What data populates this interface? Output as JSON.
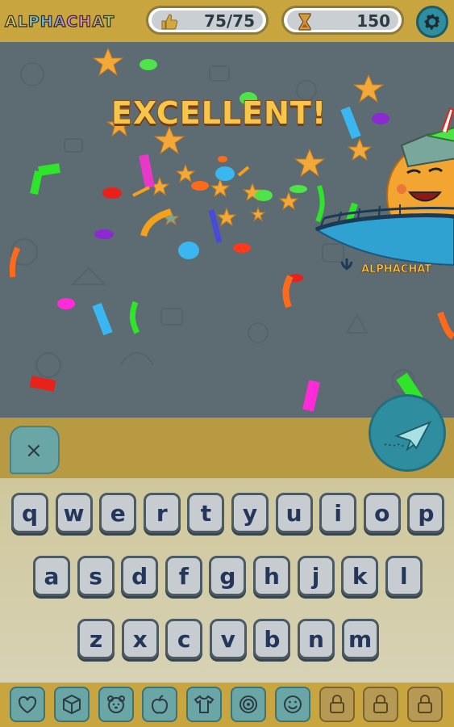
{
  "header": {
    "logo_text": "ALPHACHAT",
    "likes_counter": "75/75",
    "timer_counter": "150"
  },
  "game": {
    "message": "EXCELLENT!",
    "boat_text": "ALPHACHAT"
  },
  "input": {
    "clear_label": "×"
  },
  "keyboard": {
    "row1": [
      "q",
      "w",
      "e",
      "r",
      "t",
      "y",
      "u",
      "i",
      "o",
      "p"
    ],
    "row2": [
      "a",
      "s",
      "d",
      "f",
      "g",
      "h",
      "j",
      "k",
      "l"
    ],
    "row3": [
      "z",
      "x",
      "c",
      "v",
      "b",
      "n",
      "m"
    ]
  },
  "toolbar": {
    "items": [
      {
        "icon": "heart-icon",
        "locked": false
      },
      {
        "icon": "cube-icon",
        "locked": false
      },
      {
        "icon": "bear-face-icon",
        "locked": false
      },
      {
        "icon": "apple-icon",
        "locked": false
      },
      {
        "icon": "shirt-icon",
        "locked": false
      },
      {
        "icon": "target-icon",
        "locked": false
      },
      {
        "icon": "smiley-icon",
        "locked": false
      },
      {
        "icon": "lock-icon",
        "locked": true
      },
      {
        "icon": "lock-icon",
        "locked": true
      },
      {
        "icon": "lock-icon",
        "locked": true
      }
    ]
  },
  "colors": {
    "topbar": "#c8a53f",
    "game_bg": "#5d6b73",
    "teal_button": "#2f8da0",
    "key_text": "#25365b",
    "excellent_text": "#f6c64b"
  }
}
